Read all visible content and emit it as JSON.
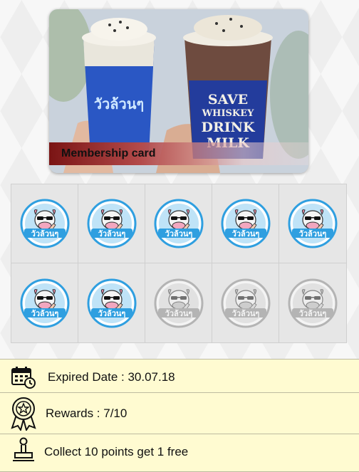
{
  "card": {
    "label": "Membership card",
    "cup_brand_text": "วัวล้วนๆ",
    "cup_slogan": [
      "SAVE",
      "WHISKEY",
      "DRINK",
      "MILK"
    ]
  },
  "stamps": {
    "total": 10,
    "collected": 7,
    "brand_text": "วัวล้วนๆ"
  },
  "info": {
    "expire": "Expired  Date : 30.07.18",
    "rewards": "Rewards : 7/10",
    "collect": "Collect 10 points get 1 free"
  },
  "colors": {
    "accent_red": "#7a1414",
    "row_background": "#fffbd1",
    "stamp_blue": "#2f9fe0"
  }
}
